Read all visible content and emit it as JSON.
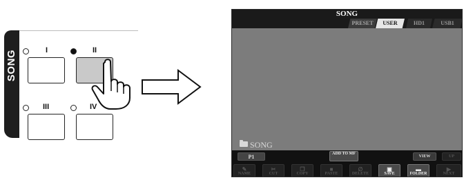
{
  "panel": {
    "side_label": "SONG",
    "buttons": [
      {
        "label": "I",
        "led": "off",
        "pressed": false
      },
      {
        "label": "II",
        "led": "on",
        "pressed": true
      },
      {
        "label": "III",
        "led": "off",
        "pressed": false
      },
      {
        "label": "IV",
        "led": "off",
        "pressed": false
      }
    ]
  },
  "screen": {
    "title": "SONG",
    "tabs": [
      {
        "label": "PRESET",
        "active": false
      },
      {
        "label": "USER",
        "active": true
      },
      {
        "label": "HD1",
        "active": false
      },
      {
        "label": "USB1",
        "active": false
      }
    ],
    "folder_path": "SONG",
    "page_button": "P1",
    "add_to_mf": "ADD TO MF",
    "view": "VIEW",
    "up": "UP",
    "functions": [
      {
        "label": "NAME",
        "icon": "name-icon",
        "enabled": false
      },
      {
        "label": "CUT",
        "icon": "cut-icon",
        "enabled": false
      },
      {
        "label": "COPY",
        "icon": "copy-icon",
        "enabled": false
      },
      {
        "label": "PASTE",
        "icon": "paste-icon",
        "enabled": false
      },
      {
        "label": "DELETE",
        "icon": "delete-icon",
        "enabled": false
      },
      {
        "label": "SAVE",
        "icon": "save-icon",
        "enabled": true
      },
      {
        "label": "FOLDER",
        "icon": "folder-icon",
        "enabled": true
      },
      {
        "label": "NEXT",
        "icon": "next-icon",
        "enabled": false
      }
    ]
  },
  "colors": {
    "screen_bg": "#7c7c7c",
    "title_bar": "#1a1a1a",
    "active_tab": "#e6e6e6",
    "pressed_button": "#c9c9c9"
  }
}
